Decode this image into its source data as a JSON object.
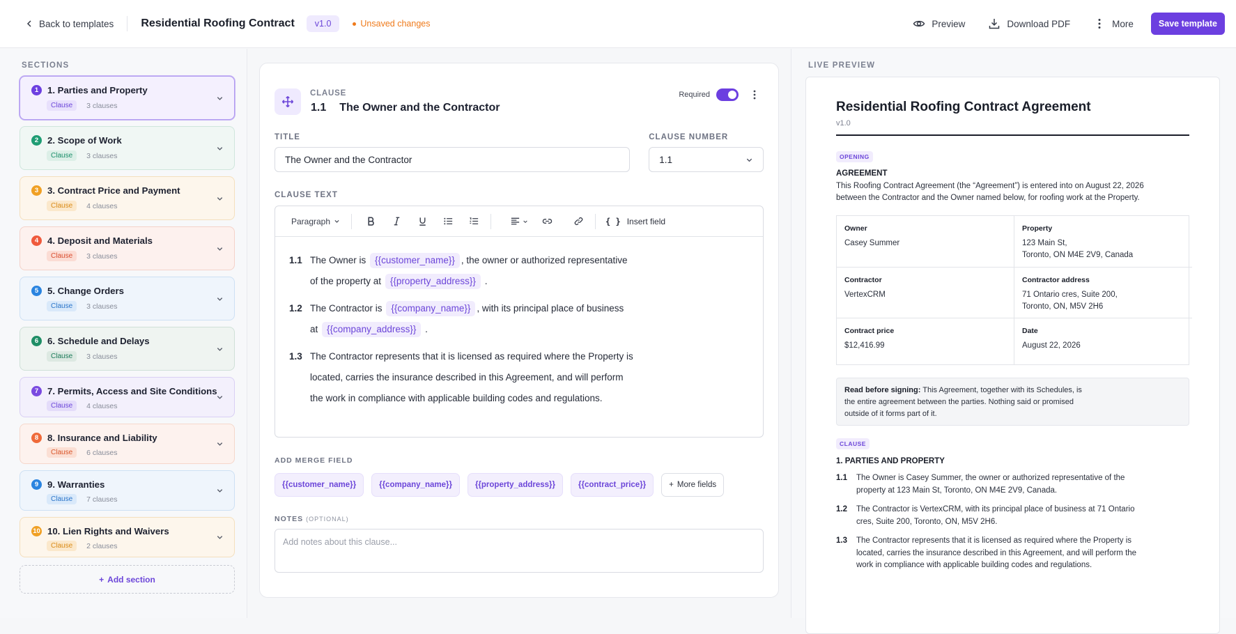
{
  "header": {
    "back_label": "Back to templates",
    "title": "Residential Roofing Contract",
    "version": "v1.0",
    "unsaved": "Unsaved changes",
    "preview_label": "Preview",
    "download_label": "Download PDF",
    "more_label": "More",
    "save_label": "Save template"
  },
  "sidebar": {
    "heading": "SECTIONS",
    "items": [
      {
        "num": "1",
        "name": "1. Parties and Property",
        "tag": "Clause",
        "count": "3 clauses",
        "color": "#6c3fe0"
      },
      {
        "num": "2",
        "name": "2. Scope of Work",
        "tag": "Clause",
        "count": "3 clauses",
        "color": "#1f9d74"
      },
      {
        "num": "3",
        "name": "3. Contract Price and Payment",
        "tag": "Clause",
        "count": "4 clauses",
        "color": "#f0a024"
      },
      {
        "num": "4",
        "name": "4. Deposit and Materials",
        "tag": "Clause",
        "count": "3 clauses",
        "color": "#ef5a3c"
      },
      {
        "num": "5",
        "name": "5. Change Orders",
        "tag": "Clause",
        "count": "3 clauses",
        "color": "#2a84e0"
      },
      {
        "num": "6",
        "name": "6. Schedule and Delays",
        "tag": "Clause",
        "count": "3 clauses",
        "color": "#1f8e66"
      },
      {
        "num": "7",
        "name": "7. Permits, Access and Site Conditions",
        "tag": "Clause",
        "count": "4 clauses",
        "color": "#7a4ae0"
      },
      {
        "num": "8",
        "name": "8. Insurance and Liability",
        "tag": "Clause",
        "count": "6 clauses",
        "color": "#ef6a3a"
      },
      {
        "num": "9",
        "name": "9. Warranties",
        "tag": "Clause",
        "count": "7 clauses",
        "color": "#2a84e0"
      },
      {
        "num": "10",
        "name": "10. Lien Rights and Waivers",
        "tag": "Clause",
        "count": "2 clauses",
        "color": "#f0a024"
      }
    ],
    "add_label": "Add section"
  },
  "editor": {
    "kicker": "CLAUSE",
    "clause_num": "1.1",
    "clause_title": "The Owner and the Contractor",
    "required_label": "Required",
    "title_label": "TITLE",
    "title_value": "The Owner and the Contractor",
    "number_label": "CLAUSE NUMBER",
    "number_value": "1.1",
    "text_label": "CLAUSE TEXT",
    "paragraph_label": "Paragraph",
    "insert_field_label": "Insert field",
    "clauses": [
      {
        "num": "1.1",
        "t1": "The Owner is",
        "f1": "{{customer_name}}",
        "t2": ", the owner or authorized representative",
        "t3": "of the property at",
        "f2": "{{property_address}}",
        "t4": "."
      },
      {
        "num": "1.2",
        "t1": "The Contractor is",
        "f1": "{{company_name}}",
        "t2": ", with its principal place of business",
        "t3": "at",
        "f2": "{{company_address}}",
        "t4": "."
      },
      {
        "num": "1.3",
        "l1": "The Contractor represents that it is licensed as required where the Property is",
        "l2": "located, carries the insurance described in this Agreement, and will perform",
        "l3": "the work in compliance with applicable building codes and regulations."
      }
    ],
    "merge_label": "ADD MERGE FIELD",
    "merge_fields": [
      "{{customer_name}}",
      "{{company_name}}",
      "{{property_address}}",
      "{{contract_price}}"
    ],
    "more_fields_label": "More fields",
    "notes_label": "NOTES",
    "notes_optional": "(OPTIONAL)",
    "notes_placeholder": "Add notes about this clause..."
  },
  "preview": {
    "heading": "LIVE PREVIEW",
    "title": "Residential Roofing Contract Agreement",
    "version": "v1.0",
    "opening_tag": "OPENING",
    "agreement_heading": "AGREEMENT",
    "agreement_l1": "This Roofing Contract Agreement (the “Agreement”) is entered into on August 22, 2026",
    "agreement_l2": "between the Contractor and the Owner named below, for roofing work at the Property.",
    "table": {
      "owner_label": "Owner",
      "owner": "Casey Summer",
      "property_label": "Property",
      "property_l1": "123 Main St,",
      "property_l2": "Toronto, ON M4E 2V9, Canada",
      "contractor_label": "Contractor",
      "contractor": "VertexCRM",
      "caddr_label": "Contractor address",
      "caddr_l1": "71 Ontario cres, Suite 200,",
      "caddr_l2": "Toronto, ON, M5V 2H6",
      "price_label": "Contract price",
      "price": "$12,416.99",
      "date_label": "Date",
      "date": "August 22, 2026"
    },
    "notice_bold": "Read before signing:",
    "notice_l1": " This Agreement, together with its Schedules, is",
    "notice_l2": "the entire agreement between the parties. Nothing said or promised",
    "notice_l3": "outside of it forms part of it.",
    "clause_tag": "CLAUSE",
    "section_heading": "1. PARTIES AND PROPERTY",
    "clauses": [
      {
        "num": "1.1",
        "text": "The Owner is Casey Summer, the owner or authorized representative of the property at 123 Main St, Toronto, ON M4E 2V9, Canada."
      },
      {
        "num": "1.2",
        "text": "The Contractor is VertexCRM, with its principal place of business at 71 Ontario cres, Suite 200, Toronto, ON, M5V 2H6."
      },
      {
        "num": "1.3",
        "text": "The Contractor represents that it is licensed as required where the Property is located, carries the insurance described in this Agreement, and will perform the work in compliance with applicable building codes and regulations."
      }
    ]
  }
}
